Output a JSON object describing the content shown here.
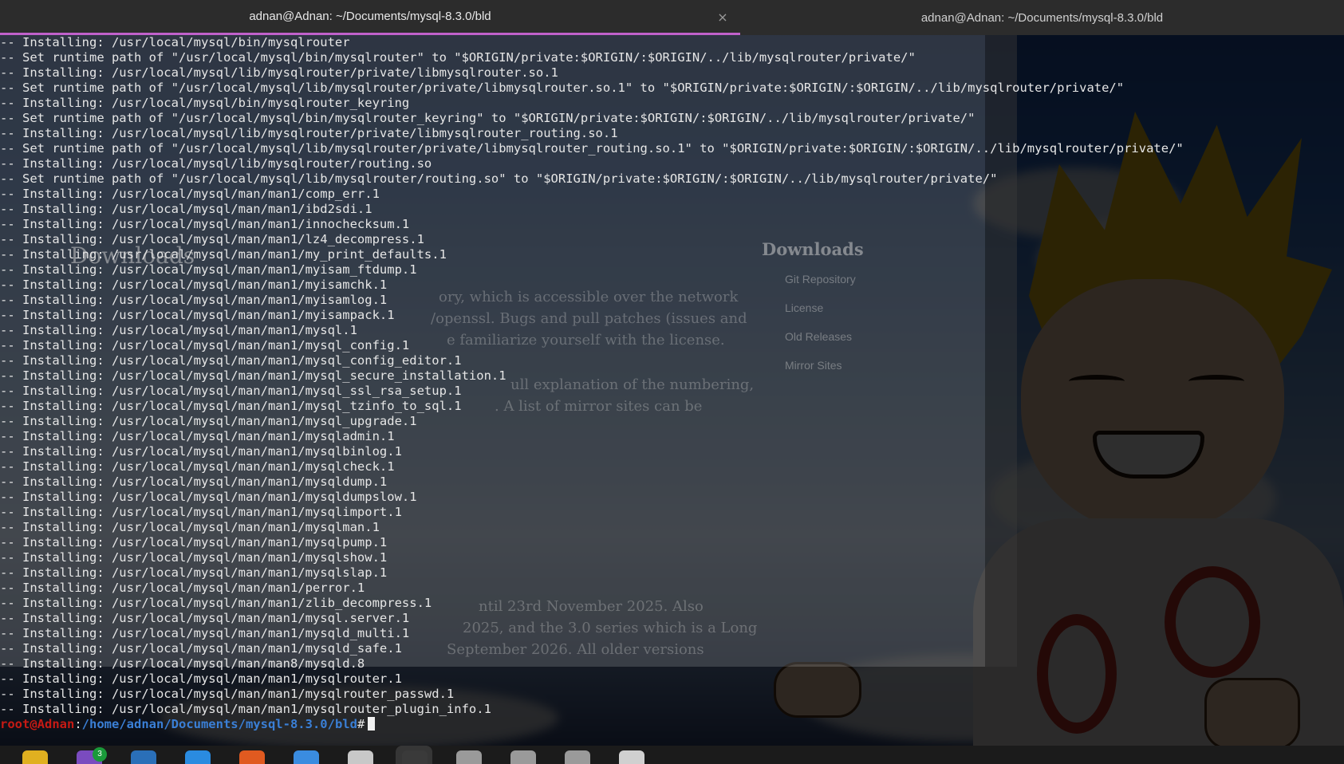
{
  "window": {
    "tabs": [
      {
        "title": "adnan@Adnan: ~/Documents/mysql-8.3.0/bld",
        "active": true
      },
      {
        "title": "adnan@Adnan: ~/Documents/mysql-8.3.0/bld",
        "active": false
      }
    ]
  },
  "terminal": {
    "lines": [
      "-- Installing: /usr/local/mysql/bin/mysqlrouter",
      "-- Set runtime path of \"/usr/local/mysql/bin/mysqlrouter\" to \"$ORIGIN/private:$ORIGIN/:$ORIGIN/../lib/mysqlrouter/private/\"",
      "-- Installing: /usr/local/mysql/lib/mysqlrouter/private/libmysqlrouter.so.1",
      "-- Set runtime path of \"/usr/local/mysql/lib/mysqlrouter/private/libmysqlrouter.so.1\" to \"$ORIGIN/private:$ORIGIN/:$ORIGIN/../lib/mysqlrouter/private/\"",
      "-- Installing: /usr/local/mysql/bin/mysqlrouter_keyring",
      "-- Set runtime path of \"/usr/local/mysql/bin/mysqlrouter_keyring\" to \"$ORIGIN/private:$ORIGIN/:$ORIGIN/../lib/mysqlrouter/private/\"",
      "-- Installing: /usr/local/mysql/lib/mysqlrouter/private/libmysqlrouter_routing.so.1",
      "-- Set runtime path of \"/usr/local/mysql/lib/mysqlrouter/private/libmysqlrouter_routing.so.1\" to \"$ORIGIN/private:$ORIGIN/:$ORIGIN/../lib/mysqlrouter/private/\"",
      "-- Installing: /usr/local/mysql/lib/mysqlrouter/routing.so",
      "-- Set runtime path of \"/usr/local/mysql/lib/mysqlrouter/routing.so\" to \"$ORIGIN/private:$ORIGIN/:$ORIGIN/../lib/mysqlrouter/private/\"",
      "-- Installing: /usr/local/mysql/man/man1/comp_err.1",
      "-- Installing: /usr/local/mysql/man/man1/ibd2sdi.1",
      "-- Installing: /usr/local/mysql/man/man1/innochecksum.1",
      "-- Installing: /usr/local/mysql/man/man1/lz4_decompress.1",
      "-- Installing: /usr/local/mysql/man/man1/my_print_defaults.1",
      "-- Installing: /usr/local/mysql/man/man1/myisam_ftdump.1",
      "-- Installing: /usr/local/mysql/man/man1/myisamchk.1",
      "-- Installing: /usr/local/mysql/man/man1/myisamlog.1",
      "-- Installing: /usr/local/mysql/man/man1/myisampack.1",
      "-- Installing: /usr/local/mysql/man/man1/mysql.1",
      "-- Installing: /usr/local/mysql/man/man1/mysql_config.1",
      "-- Installing: /usr/local/mysql/man/man1/mysql_config_editor.1",
      "-- Installing: /usr/local/mysql/man/man1/mysql_secure_installation.1",
      "-- Installing: /usr/local/mysql/man/man1/mysql_ssl_rsa_setup.1",
      "-- Installing: /usr/local/mysql/man/man1/mysql_tzinfo_to_sql.1",
      "-- Installing: /usr/local/mysql/man/man1/mysql_upgrade.1",
      "-- Installing: /usr/local/mysql/man/man1/mysqladmin.1",
      "-- Installing: /usr/local/mysql/man/man1/mysqlbinlog.1",
      "-- Installing: /usr/local/mysql/man/man1/mysqlcheck.1",
      "-- Installing: /usr/local/mysql/man/man1/mysqldump.1",
      "-- Installing: /usr/local/mysql/man/man1/mysqldumpslow.1",
      "-- Installing: /usr/local/mysql/man/man1/mysqlimport.1",
      "-- Installing: /usr/local/mysql/man/man1/mysqlman.1",
      "-- Installing: /usr/local/mysql/man/man1/mysqlpump.1",
      "-- Installing: /usr/local/mysql/man/man1/mysqlshow.1",
      "-- Installing: /usr/local/mysql/man/man1/mysqlslap.1",
      "-- Installing: /usr/local/mysql/man/man1/perror.1",
      "-- Installing: /usr/local/mysql/man/man1/zlib_decompress.1",
      "-- Installing: /usr/local/mysql/man/man1/mysql.server.1",
      "-- Installing: /usr/local/mysql/man/man1/mysqld_multi.1",
      "-- Installing: /usr/local/mysql/man/man1/mysqld_safe.1",
      "-- Installing: /usr/local/mysql/man/man8/mysqld.8",
      "-- Installing: /usr/local/mysql/man/man1/mysqlrouter.1",
      "-- Installing: /usr/local/mysql/man/man1/mysqlrouter_passwd.1",
      "-- Installing: /usr/local/mysql/man/man1/mysqlrouter_plugin_info.1"
    ],
    "prompt": {
      "user_host": "root@Adnan",
      "separator": ":",
      "path": "/home/adnan/Documents/mysql-8.3.0/bld",
      "symbol": "#"
    }
  },
  "background_browser": {
    "heading": "Downloads",
    "sidebar_title": "Downloads",
    "sidebar_links": [
      "Git Repository",
      "License",
      "Old Releases",
      "Mirror Sites"
    ],
    "paragraph_fragments": [
      "ory, which is accessible over the network",
      "/openssl. Bugs and pull patches (issues and",
      "e familiarize yourself with the license.",
      "ull explanation of the numbering,",
      ". A list of mirror sites can be",
      "ntil 23rd November 2025. Also",
      "2025, and the 3.0 series which is a Long",
      "September 2026. All older versions"
    ]
  },
  "dock": {
    "items": [
      {
        "name": "files-icon",
        "color": "#e0b020",
        "badge": ""
      },
      {
        "name": "folder-icon",
        "color": "#7a4bbf",
        "badge": "3"
      },
      {
        "name": "editor-icon",
        "color": "#2a6fb8",
        "badge": ""
      },
      {
        "name": "thunderbird-icon",
        "color": "#2a8be0",
        "badge": ""
      },
      {
        "name": "software-center-icon",
        "color": "#e05a20",
        "badge": ""
      },
      {
        "name": "chrome-icon",
        "color": "#3a8ce0",
        "badge": ""
      },
      {
        "name": "settings-icon",
        "color": "#c8c8c8",
        "badge": ""
      },
      {
        "name": "terminal-icon",
        "color": "#3a3a3a",
        "badge": ""
      },
      {
        "name": "window-icon",
        "color": "#9a9a9a",
        "badge": ""
      },
      {
        "name": "window-icon",
        "color": "#9a9a9a",
        "badge": ""
      },
      {
        "name": "window-icon",
        "color": "#9a9a9a",
        "badge": ""
      },
      {
        "name": "printer-icon",
        "color": "#d0d0d0",
        "badge": ""
      }
    ],
    "active_index": 7
  }
}
